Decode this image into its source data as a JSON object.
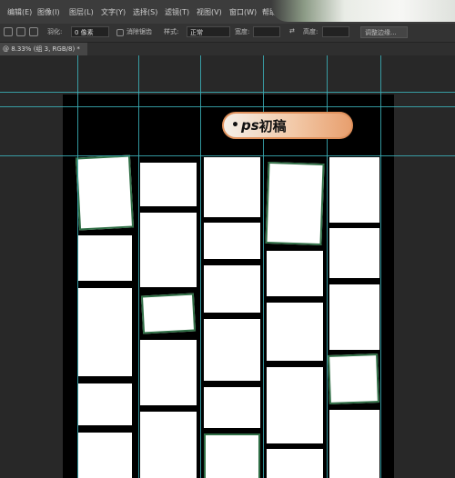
{
  "menubar": {
    "items": [
      {
        "label": "编辑(E)"
      },
      {
        "label": "图像(I)"
      },
      {
        "label": "图层(L)"
      },
      {
        "label": "文字(Y)"
      },
      {
        "label": "选择(S)"
      },
      {
        "label": "滤镜(T)"
      },
      {
        "label": "视图(V)"
      },
      {
        "label": "窗口(W)"
      },
      {
        "label": "帮助(H)"
      }
    ]
  },
  "options": {
    "feather_label": "羽化:",
    "feather_value": "0 像素",
    "antialias_label": "消除锯齿",
    "style_label": "样式:",
    "style_value": "正常",
    "width_label": "宽度:",
    "height_label": "高度:",
    "refine_button": "调整边缘..."
  },
  "document": {
    "tab_label": "@ 8.33% (组 3, RGB/8) *"
  },
  "overlay": {
    "bullet": "•",
    "ps_text": "ps",
    "title": "初稿"
  },
  "colors": {
    "guide": "#3bb0b8",
    "selected_outline": "#2f6e45",
    "badge_border": "#e0915c"
  }
}
